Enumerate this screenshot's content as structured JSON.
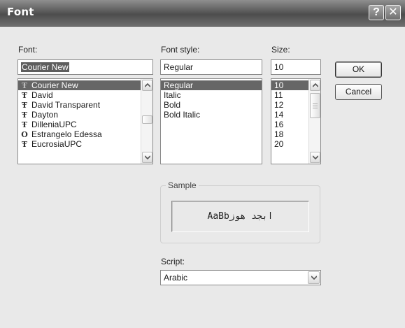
{
  "window": {
    "title": "Font",
    "help_glyph": "?",
    "close_glyph": "✕"
  },
  "font": {
    "label": "Font:",
    "value": "Courier New",
    "items": [
      {
        "name": "Courier New",
        "icon": "truetype-font-icon",
        "glyph": "Ŧ"
      },
      {
        "name": "David",
        "icon": "truetype-font-icon",
        "glyph": "Ŧ"
      },
      {
        "name": "David Transparent",
        "icon": "truetype-font-icon",
        "glyph": "Ŧ"
      },
      {
        "name": "Dayton",
        "icon": "truetype-font-icon",
        "glyph": "Ŧ"
      },
      {
        "name": "DilleniaUPC",
        "icon": "truetype-font-icon",
        "glyph": "Ŧ"
      },
      {
        "name": "Estrangelo Edessa",
        "icon": "opentype-font-icon",
        "glyph": "O"
      },
      {
        "name": "EucrosiaUPC",
        "icon": "truetype-font-icon",
        "glyph": "Ŧ"
      }
    ]
  },
  "style": {
    "label": "Font style:",
    "value": "Regular",
    "items": [
      "Regular",
      "Italic",
      "Bold",
      "Bold Italic"
    ]
  },
  "size": {
    "label": "Size:",
    "value": "10",
    "items": [
      "10",
      "11",
      "12",
      "14",
      "16",
      "18",
      "20"
    ]
  },
  "buttons": {
    "ok": "OK",
    "cancel": "Cancel"
  },
  "sample": {
    "label": "Sample",
    "text": "AaBbابجد هوز"
  },
  "script": {
    "label": "Script:",
    "value": "Arabic"
  },
  "colors": {
    "titlebar": "#5a5a5a",
    "selection": "#666666",
    "background": "#e9e9e9"
  }
}
